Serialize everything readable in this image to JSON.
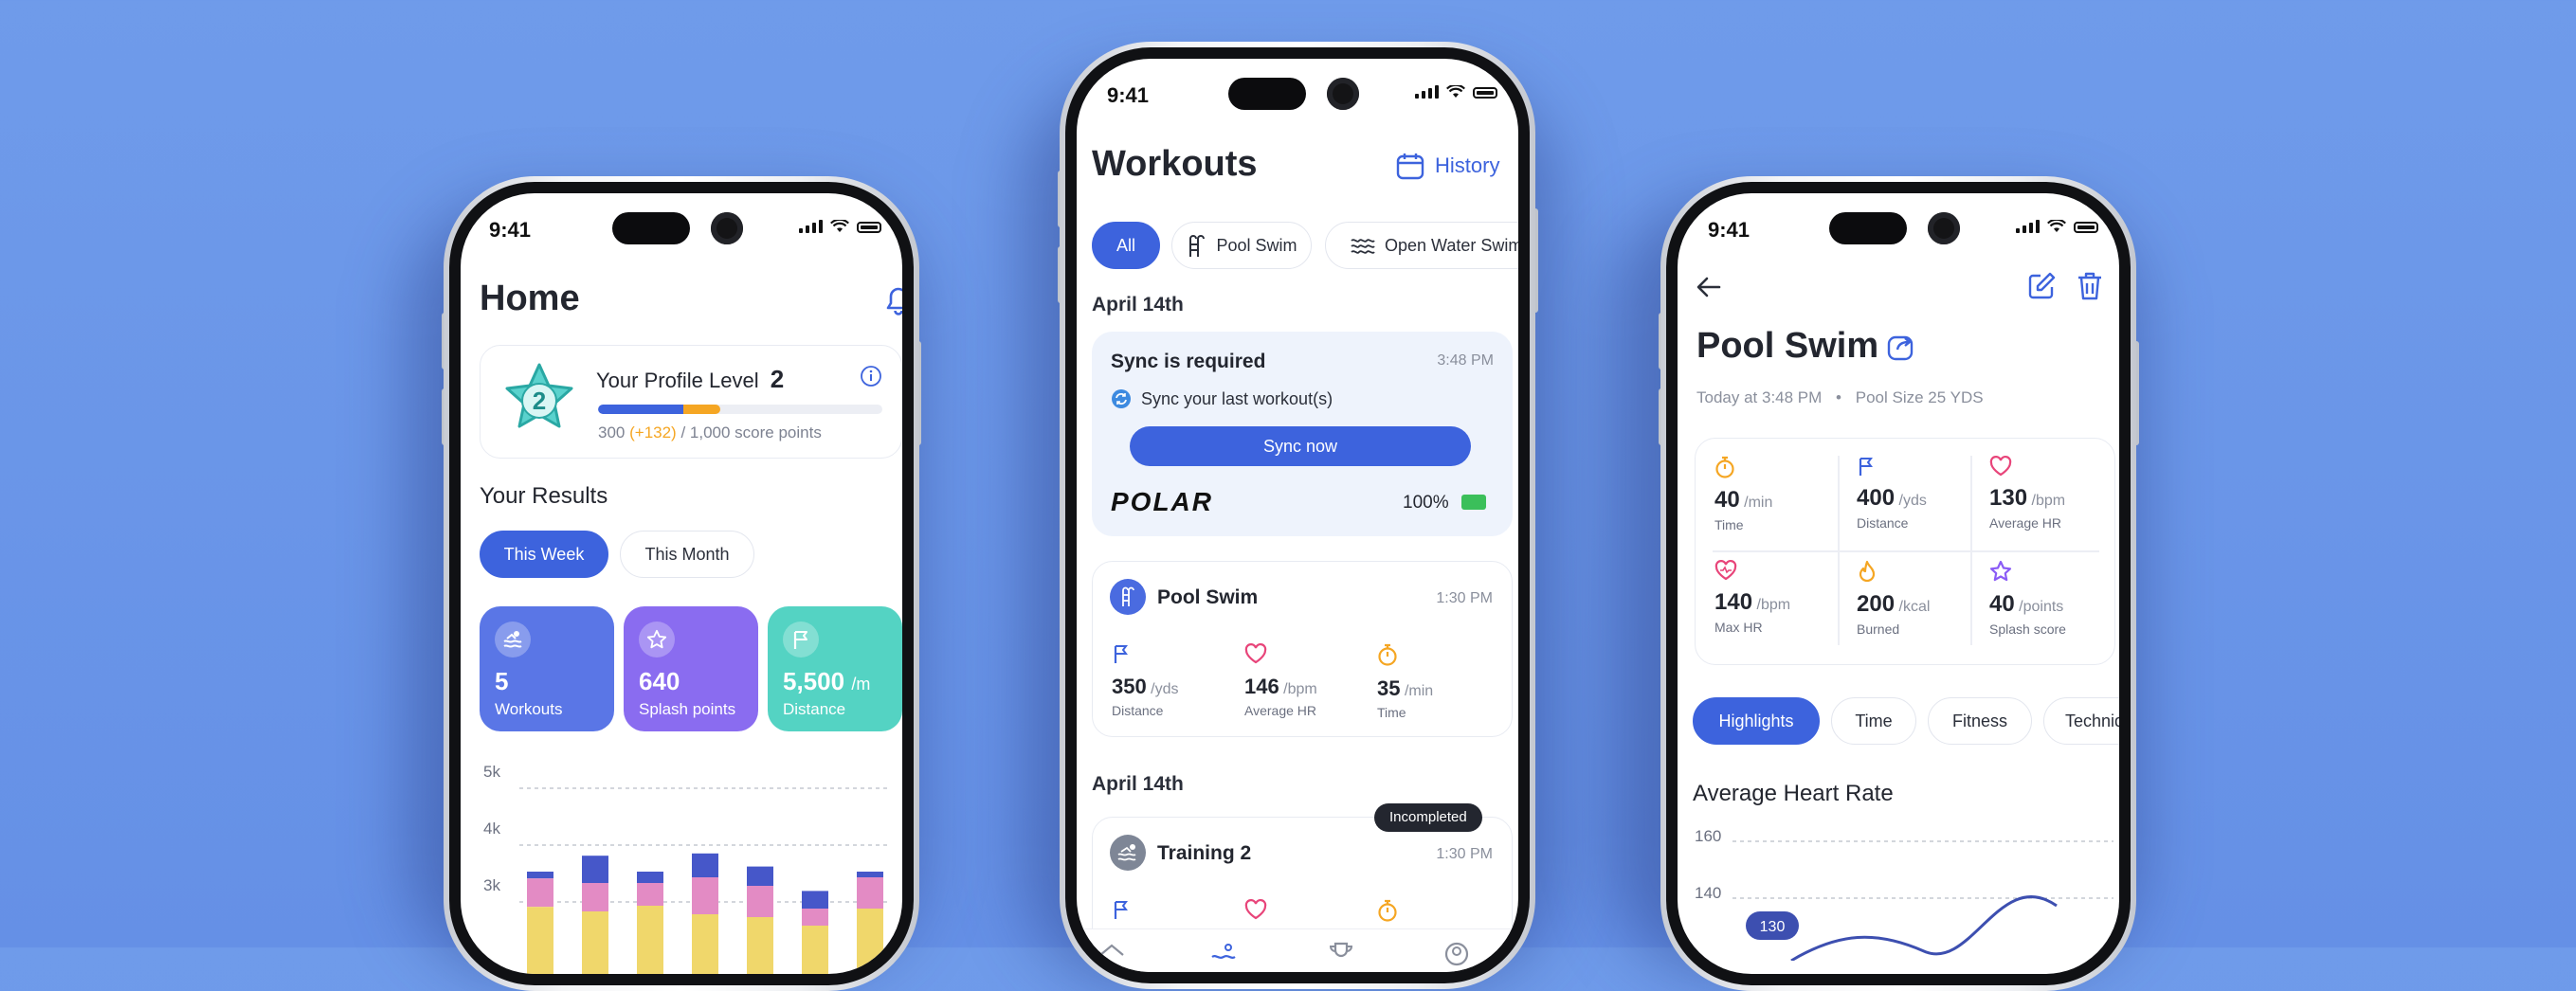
{
  "status_time": "9:41",
  "colors": {
    "background": "#6b95e8",
    "accent": "#3d63dd",
    "orange": "#f5a623",
    "pink": "#e8457a",
    "purple": "#8b5cf6",
    "teal": "#4fd1c5"
  },
  "home": {
    "title": "Home",
    "profile": {
      "label": "Your Profile Level",
      "level": "2",
      "points_base": "300",
      "points_gain": "(+132)",
      "points_rest": "/ 1,000 score points",
      "progress_blue": 0.3,
      "progress_orange": 0.13
    },
    "results_title": "Your Results",
    "tabs": [
      "This Week",
      "This Month"
    ],
    "tiles": [
      {
        "value": "5",
        "unit": "",
        "label": "Workouts",
        "icon": "swim-icon"
      },
      {
        "value": "640",
        "unit": "",
        "label": "Splash points",
        "icon": "star-icon"
      },
      {
        "value": "5,500",
        "unit": "/m",
        "label": "Distance",
        "icon": "flag-icon"
      }
    ],
    "chart_data": {
      "type": "bar",
      "yticks": [
        "5k",
        "4k",
        "3k"
      ],
      "ylim": [
        0,
        5000
      ],
      "series_colors": [
        "#4657c9",
        "#e38bc4",
        "#f0d76b"
      ],
      "stacks": [
        [
          2780,
          3280,
          3400
        ],
        [
          2700,
          3200,
          3680
        ],
        [
          2800,
          3200,
          3400
        ],
        [
          2650,
          3300,
          3720
        ],
        [
          2600,
          3150,
          3490
        ],
        [
          2450,
          2750,
          3060
        ],
        [
          2750,
          3300,
          3400
        ]
      ]
    }
  },
  "workouts": {
    "title": "Workouts",
    "history_label": "History",
    "filters": [
      "All",
      "Pool Swim",
      "Open Water Swim"
    ],
    "date1": "April 14th",
    "sync": {
      "title": "Sync is required",
      "time": "3:48 PM",
      "message": "Sync your last workout(s)",
      "button": "Sync now",
      "brand": "POLAR",
      "battery": "100%"
    },
    "workout1": {
      "name": "Pool Swim",
      "time": "1:30 PM",
      "stats": [
        {
          "value": "350",
          "unit": "/yds",
          "label": "Distance",
          "icon": "flag-icon"
        },
        {
          "value": "146",
          "unit": "/bpm",
          "label": "Average HR",
          "icon": "heart-icon"
        },
        {
          "value": "35",
          "unit": "/min",
          "label": "Time",
          "icon": "stopwatch-icon"
        }
      ]
    },
    "date2": "April 14th",
    "workout2": {
      "name": "Training 2",
      "time": "1:30 PM",
      "badge": "Incompleted"
    }
  },
  "detail": {
    "title": "Pool Swim",
    "subtitle_time": "Today at 3:48 PM",
    "subtitle_pool": "Pool Size 25 YDS",
    "stats": [
      {
        "value": "40",
        "unit": "/min",
        "label": "Time",
        "icon": "stopwatch-icon",
        "color": "#f5a623"
      },
      {
        "value": "400",
        "unit": "/yds",
        "label": "Distance",
        "icon": "flag-icon",
        "color": "#3d63dd"
      },
      {
        "value": "130",
        "unit": "/bpm",
        "label": "Average HR",
        "icon": "heart-icon",
        "color": "#e8457a"
      },
      {
        "value": "140",
        "unit": "/bpm",
        "label": "Max HR",
        "icon": "heart-pulse-icon",
        "color": "#e8457a"
      },
      {
        "value": "200",
        "unit": "/kcal",
        "label": "Burned",
        "icon": "flame-icon",
        "color": "#f5a623"
      },
      {
        "value": "40",
        "unit": "/points",
        "label": "Splash score",
        "icon": "star-icon",
        "color": "#8b5cf6"
      }
    ],
    "tabs": [
      "Highlights",
      "Time",
      "Fitness",
      "Technique"
    ],
    "hr_title": "Average Heart Rate",
    "hr_ticks": [
      "160",
      "140"
    ],
    "hr_badge": "130"
  }
}
